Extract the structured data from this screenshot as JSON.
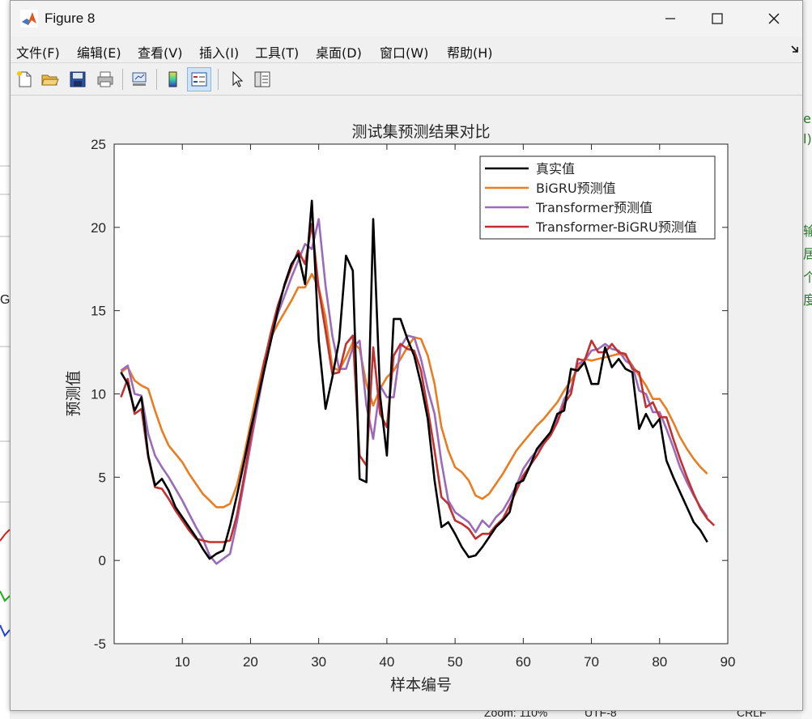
{
  "window": {
    "title": "Figure 8"
  },
  "menu": {
    "items": [
      {
        "label": "文件(F)"
      },
      {
        "label": "编辑(E)"
      },
      {
        "label": "查看(V)"
      },
      {
        "label": "插入(I)"
      },
      {
        "label": "工具(T)"
      },
      {
        "label": "桌面(D)"
      },
      {
        "label": "窗口(W)"
      },
      {
        "label": "帮助(H)"
      }
    ]
  },
  "toolbar": {
    "icons": [
      "new-figure-icon",
      "open-file-icon",
      "save-icon",
      "print-icon",
      "link-plot-icon",
      "colorbar-icon",
      "legend-icon",
      "pointer-icon",
      "property-inspector-icon"
    ]
  },
  "background": {
    "right_chars": [
      "e",
      "l)",
      "输",
      "居",
      "个",
      "度"
    ],
    "left_chars": [
      "G"
    ],
    "status": {
      "zoom": "Zoom: 110%",
      "encoding": "UTF-8",
      "eol": "CRLF"
    }
  },
  "chart_data": {
    "type": "line",
    "title": "测试集预测结果对比",
    "xlabel": "样本编号",
    "ylabel": "预测值",
    "xlim": [
      0,
      90
    ],
    "ylim": [
      -5,
      25
    ],
    "xticks": [
      10,
      20,
      30,
      40,
      50,
      60,
      70,
      80,
      90
    ],
    "yticks": [
      -5,
      0,
      5,
      10,
      15,
      20,
      25
    ],
    "legend_position": "top-right",
    "series": [
      {
        "name": "真实值",
        "color": "#000000",
        "values": [
          11.3,
          10.6,
          9,
          9.8,
          6.3,
          4.5,
          4.9,
          4.2,
          3.2,
          2.6,
          2,
          1.4,
          0.7,
          0.1,
          0.4,
          0.6,
          2.1,
          3.9,
          5.8,
          7.8,
          9.6,
          11.4,
          13.2,
          15,
          16.6,
          17.8,
          18.4,
          16.6,
          21.6,
          13.2,
          9.1,
          11,
          13.2,
          18.3,
          17.4,
          4.9,
          4.7,
          20.5,
          9.9,
          6.3,
          14.5,
          14.5,
          13.3,
          12.3,
          10.6,
          8.5,
          4.8,
          2,
          2.3,
          1.6,
          0.8,
          0.2,
          0.3,
          0.8,
          1.4,
          2,
          2.4,
          2.9,
          4.6,
          4.8,
          5.7,
          6.7,
          7.2,
          7.7,
          8.8,
          9,
          11.5,
          11.4,
          11.9,
          10.6,
          10.6,
          12.8,
          11.6,
          12.1,
          11.5,
          11.3,
          7.9,
          8.8,
          8,
          8.5,
          6,
          5,
          4.1,
          3.2,
          2.3,
          1.8,
          1.1
        ]
      },
      {
        "name": "BiGRU预测值",
        "color": "#e87d22",
        "values": [
          11.3,
          11.6,
          10.8,
          10.5,
          10.3,
          9,
          7.8,
          6.9,
          6.4,
          5.9,
          5.2,
          4.6,
          4,
          3.6,
          3.2,
          3.2,
          3.4,
          4.5,
          6.2,
          8.2,
          10.2,
          12,
          13.4,
          14.2,
          14.9,
          15.6,
          16.4,
          16.4,
          17.2,
          16.4,
          14.6,
          11.6,
          11.4,
          12.2,
          13.1,
          12.7,
          10.6,
          9.3,
          10.3,
          11,
          11.4,
          12.1,
          12.8,
          13.4,
          13.3,
          12.3,
          10.6,
          8,
          6.6,
          5.6,
          5.3,
          4.8,
          3.9,
          3.7,
          4,
          4.6,
          5.2,
          5.9,
          6.6,
          7.1,
          7.6,
          8.1,
          8.5,
          9,
          9.5,
          10.2,
          10.8,
          11.5,
          12.1,
          12,
          12.1,
          12.2,
          12.3,
          12.4,
          12.3,
          11.7,
          11.1,
          10.5,
          9.7,
          9.7,
          9.1,
          8.3,
          7.4,
          6.7,
          6.1,
          5.6,
          5.2
        ]
      },
      {
        "name": "Transformer预测值",
        "color": "#9a6bb9",
        "values": [
          11.4,
          11.7,
          10,
          9.9,
          7.6,
          6.3,
          5.6,
          5,
          4.3,
          3.6,
          2.8,
          2,
          1.3,
          0.3,
          -0.2,
          0.1,
          0.4,
          2.3,
          4.6,
          6.9,
          9.2,
          11.4,
          13.4,
          14.8,
          15.9,
          17,
          18,
          19,
          18.7,
          20.5,
          16.5,
          13.5,
          11.5,
          11.5,
          12.8,
          13.2,
          9.3,
          7.3,
          10.5,
          9.8,
          9.8,
          12.8,
          13.5,
          13.4,
          12.1,
          10.3,
          8.8,
          5.9,
          3.6,
          2.9,
          2.6,
          2.3,
          1.7,
          2.4,
          2,
          2.6,
          3,
          3.7,
          4.5,
          5.5,
          6.1,
          6.6,
          7.1,
          7.7,
          8.5,
          9.7,
          10.3,
          11.8,
          12,
          12.6,
          12.7,
          13,
          12.7,
          12.6,
          12,
          11.7,
          10.2,
          10,
          8.9,
          8.9,
          7.9,
          6.8,
          5.6,
          4.7,
          3.9,
          3.2,
          2.6
        ]
      },
      {
        "name": "Transformer-BiGRU预测值",
        "color": "#c23030",
        "values": [
          9.8,
          10.9,
          8.8,
          9.1,
          6.2,
          4.4,
          4.3,
          3.7,
          3,
          2.4,
          1.8,
          1.3,
          1.2,
          1.1,
          1.1,
          1.1,
          1.2,
          2.7,
          4.9,
          7.3,
          9.7,
          11.9,
          13.7,
          15.3,
          16.5,
          17.6,
          18.6,
          17.8,
          20.2,
          16.3,
          13.8,
          11.2,
          11.3,
          13,
          13.5,
          6.3,
          5.7,
          12.8,
          8.8,
          8,
          12.3,
          13,
          12.7,
          12.6,
          11.4,
          9.1,
          6.6,
          3.8,
          3.4,
          2.4,
          2.2,
          1.9,
          1.3,
          1.6,
          1.6,
          2.1,
          2.5,
          3.3,
          4.2,
          5.1,
          5.7,
          6.3,
          7,
          7.5,
          8.3,
          9.4,
          10,
          12.1,
          12,
          13.2,
          12.5,
          12.5,
          13,
          12.5,
          12.4,
          11.5,
          11.3,
          9.2,
          9.5,
          8.6,
          8.6,
          7.3,
          6.1,
          5,
          4,
          3.1,
          2.5,
          2.1
        ]
      }
    ]
  }
}
